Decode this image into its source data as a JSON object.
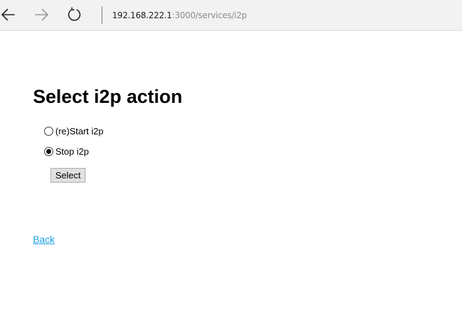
{
  "browser": {
    "address_host": "192.168.222.1",
    "address_path": ":3000/services/i2p"
  },
  "page": {
    "title": "Select i2p action",
    "options": [
      {
        "label": "(re)Start i2p",
        "checked": false
      },
      {
        "label": "Stop i2p",
        "checked": true
      }
    ],
    "submit_label": "Select",
    "back_label": "Back"
  }
}
